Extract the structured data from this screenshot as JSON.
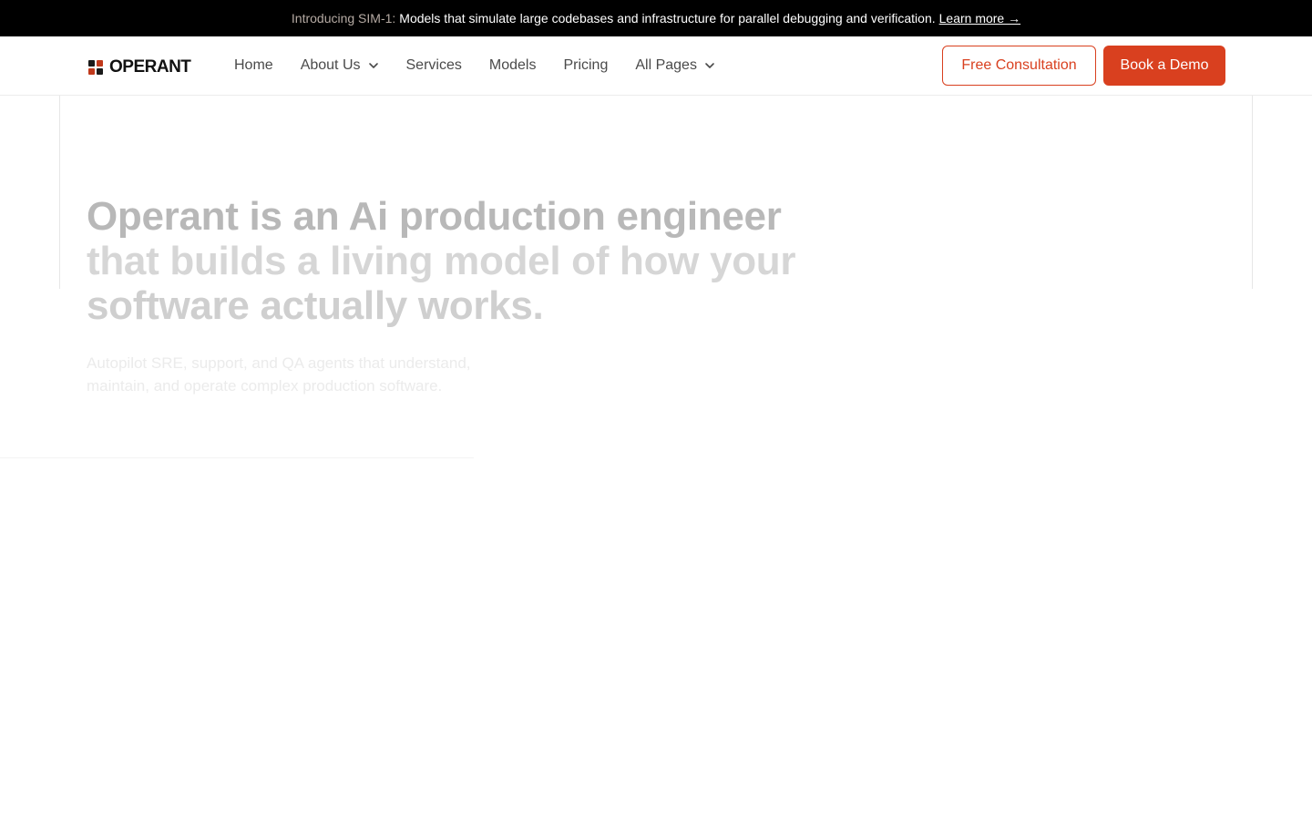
{
  "announcement": {
    "lead": "Introducing SIM-1:",
    "message": "Models that simulate large codebases and infrastructure for parallel debugging and verification.",
    "link": "Learn more →"
  },
  "brand": {
    "name": "OPERANT",
    "logo_colors": [
      "#1a1a1a",
      "#c0391b",
      "#c0391b",
      "#1a1a1a"
    ]
  },
  "nav": {
    "items": [
      {
        "label": "Home",
        "dropdown": false
      },
      {
        "label": "About Us",
        "dropdown": true
      },
      {
        "label": "Services",
        "dropdown": false
      },
      {
        "label": "Models",
        "dropdown": false
      },
      {
        "label": "Pricing",
        "dropdown": false
      },
      {
        "label": "All Pages",
        "dropdown": true
      }
    ]
  },
  "cta": {
    "consult": "Free Consultation",
    "demo": "Book a Demo"
  },
  "hero": {
    "headline_line1": "Operant is an Ai production engineer",
    "headline_line2": "that builds a living model of how your",
    "headline_line3": "software actually works.",
    "subtext_line1": "Autopilot SRE, support, and QA agents that understand,",
    "subtext_line2": "maintain, and operate complex production software."
  },
  "colors": {
    "accent": "#d9401f",
    "announcement_bg": "#000000"
  }
}
